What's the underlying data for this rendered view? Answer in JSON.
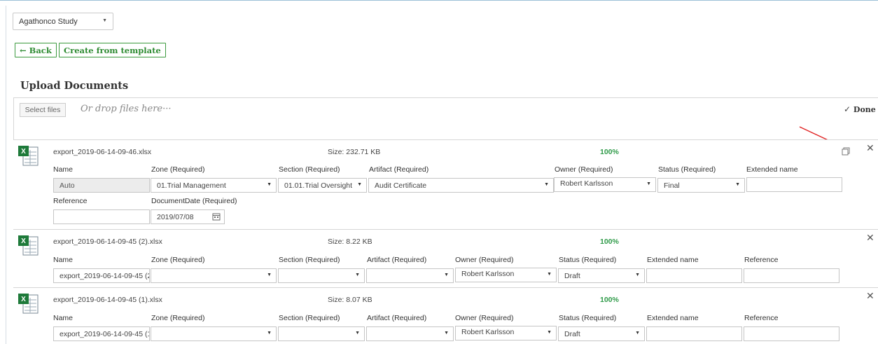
{
  "study": {
    "selected": "Agathonco Study"
  },
  "actions": {
    "back": "← Back",
    "create_from_template": "Create from template"
  },
  "upload": {
    "title": "Upload Documents",
    "select_files": "Select files",
    "drop_hint": "Or drop files here···",
    "done": "Done"
  },
  "files": [
    {
      "filename": "export_2019-06-14-09-46.xlsx",
      "size": "Size: 232.71 KB",
      "progress": "100%",
      "labels": {
        "name": "Name",
        "zone": "Zone (Required)",
        "section": "Section (Required)",
        "artifact": "Artifact (Required)",
        "owner": "Owner (Required)",
        "status": "Status (Required)",
        "extended": "Extended name",
        "reference": "Reference",
        "docdate": "DocumentDate (Required)"
      },
      "values": {
        "name": "Auto",
        "zone": "01.Trial Management",
        "section": "01.01.Trial Oversight",
        "artifact": "Audit Certificate",
        "owner": "Robert Karlsson",
        "status": "Final",
        "extended": "",
        "reference": "",
        "docdate": "2019/07/08"
      }
    },
    {
      "filename": "export_2019-06-14-09-45 (2).xlsx",
      "size": "Size: 8.22 KB",
      "progress": "100%",
      "labels": {
        "name": "Name",
        "zone": "Zone (Required)",
        "section": "Section (Required)",
        "artifact": "Artifact (Required)",
        "owner": "Owner (Required)",
        "status": "Status (Required)",
        "extended": "Extended name",
        "reference": "Reference"
      },
      "values": {
        "name": "export_2019-06-14-09-45 (2",
        "zone": "",
        "section": "",
        "artifact": "",
        "owner": "Robert Karlsson",
        "status": "Draft",
        "extended": "",
        "reference": ""
      }
    },
    {
      "filename": "export_2019-06-14-09-45 (1).xlsx",
      "size": "Size: 8.07 KB",
      "progress": "100%",
      "labels": {
        "name": "Name",
        "zone": "Zone (Required)",
        "section": "Section (Required)",
        "artifact": "Artifact (Required)",
        "owner": "Owner (Required)",
        "status": "Status (Required)",
        "extended": "Extended name",
        "reference": "Reference"
      },
      "values": {
        "name": "export_2019-06-14-09-45 (1",
        "zone": "",
        "section": "",
        "artifact": "",
        "owner": "Robert Karlsson",
        "status": "Draft",
        "extended": "",
        "reference": ""
      }
    }
  ],
  "icons": {
    "file_type": "excel-file-icon",
    "copy": "copy-icon",
    "close": "close-icon",
    "calendar": "calendar-icon",
    "dropdown": "chevron-down-icon",
    "done": "check-icon"
  },
  "colors": {
    "accent_green": "#2e8b32",
    "progress_green": "#2e9a48",
    "annotation_red": "#e02020"
  }
}
